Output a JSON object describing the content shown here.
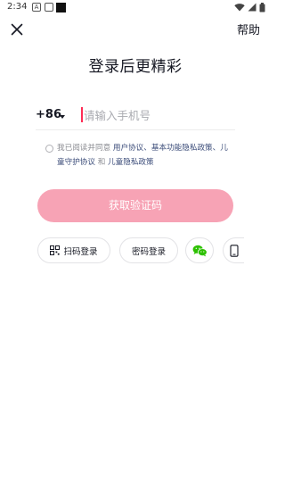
{
  "status_bar": {
    "time": "2:34",
    "notif_a": "A"
  },
  "header": {
    "help_label": "帮助"
  },
  "title": "登录后更精彩",
  "phone": {
    "country_code": "+86",
    "placeholder": "请输入手机号"
  },
  "agreement": {
    "prefix": "我已阅读并同意 ",
    "user_agreement": "用户协议",
    "sep1": "、",
    "privacy_policy": "基本功能隐私政策",
    "sep2": "、",
    "child_protection": "儿童守护协议",
    "conj": " 和 ",
    "child_privacy": "儿童隐私政策"
  },
  "buttons": {
    "get_code": "获取验证码",
    "qr_login": "扫码登录",
    "password_login": "密码登录"
  },
  "colors": {
    "accent": "#fe2c55",
    "button_disabled": "#f7a3b5",
    "link": "#3c4d7a",
    "wechat": "#2dc100"
  },
  "icons": {
    "close": "close-icon",
    "qr": "qr-scan-icon",
    "wechat": "wechat-icon",
    "phone": "phone-icon"
  }
}
